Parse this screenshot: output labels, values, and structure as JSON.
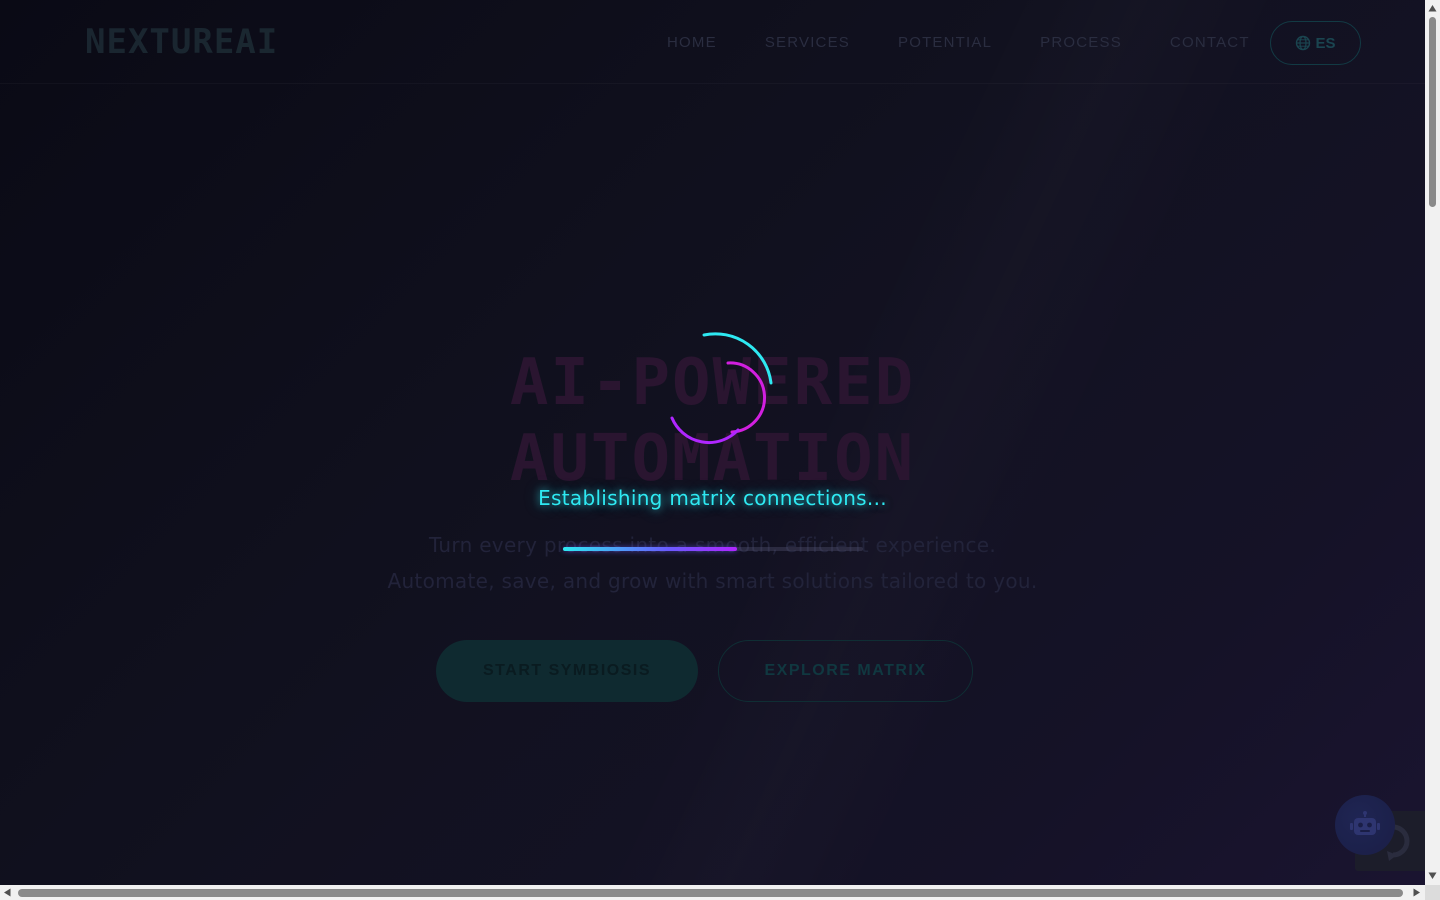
{
  "brand": {
    "logo_text": "NEXTUREAI"
  },
  "nav": {
    "links": [
      "HOME",
      "SERVICES",
      "POTENTIAL",
      "PROCESS",
      "CONTACT"
    ],
    "language_label": "ES"
  },
  "hero": {
    "title_line1": "AI-POWERED",
    "title_line2": "AUTOMATION",
    "subtitle_line1": "Turn every process into a smooth, efficient experience.",
    "subtitle_line2": "Automate, save, and grow with smart solutions tailored to you.",
    "primary_cta": "START SYMBIOSIS",
    "secondary_cta": "EXPLORE MATRIX"
  },
  "loader": {
    "message": "Establishing matrix connections...",
    "progress_fraction": 0.58
  },
  "colors": {
    "accent_cyan": "#2ee9f2",
    "accent_magenta": "#d21fe0",
    "accent_purple": "#6a5cff"
  },
  "icons": {
    "language": "globe-icon",
    "chatbot": "robot-icon",
    "recaptcha": "recaptcha-icon"
  }
}
